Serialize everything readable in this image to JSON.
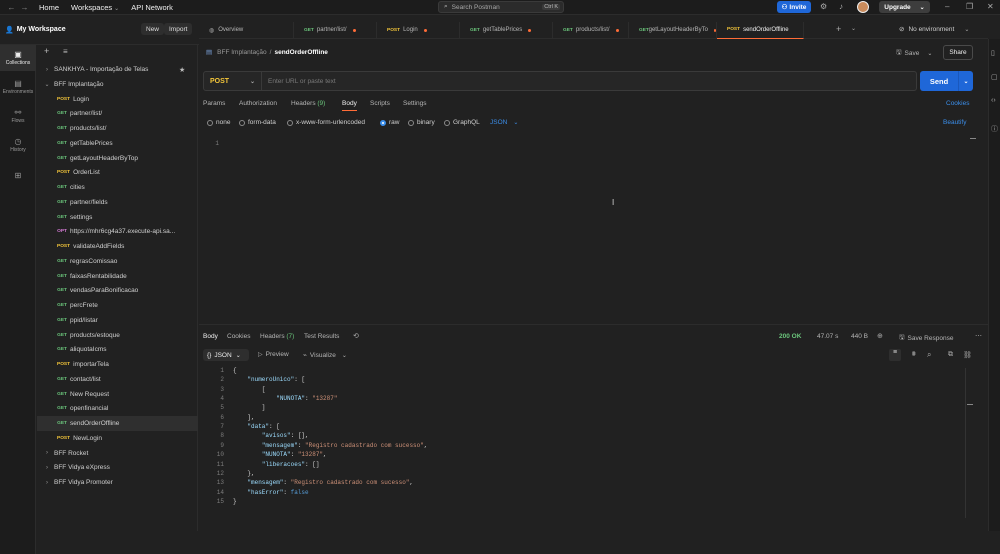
{
  "topbar": {
    "home": "Home",
    "workspaces": "Workspaces",
    "api_network": "API Network",
    "search_placeholder": "Search Postman",
    "search_shortcut": "Ctrl K",
    "invite": "Invite",
    "upgrade": "Upgrade"
  },
  "workspace": {
    "name": "My Workspace",
    "new_label": "New",
    "import_label": "Import"
  },
  "rail": [
    {
      "label": "Collections",
      "icon": "collections-icon"
    },
    {
      "label": "Environments",
      "icon": "environments-icon"
    },
    {
      "label": "Flows",
      "icon": "flows-icon"
    },
    {
      "label": "History",
      "icon": "history-icon"
    },
    {
      "label": "",
      "icon": "apps-icon"
    }
  ],
  "tree": [
    {
      "type": "collection",
      "label": "SANKHYA - Importação de Telas",
      "expanded": false,
      "star": true
    },
    {
      "type": "collection",
      "label": "BFF Implantação",
      "expanded": true
    },
    {
      "type": "request",
      "method": "POST",
      "label": "Login"
    },
    {
      "type": "request",
      "method": "GET",
      "label": "partner/list/"
    },
    {
      "type": "request",
      "method": "GET",
      "label": "products/list/"
    },
    {
      "type": "request",
      "method": "GET",
      "label": "getTablePrices"
    },
    {
      "type": "request",
      "method": "GET",
      "label": "getLayoutHeaderByTop"
    },
    {
      "type": "request",
      "method": "POST",
      "label": "OrderList"
    },
    {
      "type": "request",
      "method": "GET",
      "label": "cities"
    },
    {
      "type": "request",
      "method": "GET",
      "label": "partner/fields"
    },
    {
      "type": "request",
      "method": "GET",
      "label": "settings"
    },
    {
      "type": "request",
      "method": "OPT",
      "label": "https://mhr6cg4a37.execute-api.sa..."
    },
    {
      "type": "request",
      "method": "POST",
      "label": "validateAddFields"
    },
    {
      "type": "request",
      "method": "GET",
      "label": "regrasComissao"
    },
    {
      "type": "request",
      "method": "GET",
      "label": "faixasRentabilidade"
    },
    {
      "type": "request",
      "method": "GET",
      "label": "vendasParaBonificacao"
    },
    {
      "type": "request",
      "method": "GET",
      "label": "percFrete"
    },
    {
      "type": "request",
      "method": "GET",
      "label": "ppid/listar"
    },
    {
      "type": "request",
      "method": "GET",
      "label": "products/estoque"
    },
    {
      "type": "request",
      "method": "GET",
      "label": "aliquotaIcms"
    },
    {
      "type": "request",
      "method": "POST",
      "label": "importarTela"
    },
    {
      "type": "request",
      "method": "GET",
      "label": "contact/list"
    },
    {
      "type": "request",
      "method": "GET",
      "label": "New Request"
    },
    {
      "type": "request",
      "method": "GET",
      "label": "openfinancial"
    },
    {
      "type": "request",
      "method": "GET",
      "label": "sendOrderOffline",
      "selected": true
    },
    {
      "type": "request",
      "method": "POST",
      "label": "NewLogin"
    },
    {
      "type": "collection",
      "label": "BFF Rocket",
      "expanded": false
    },
    {
      "type": "collection",
      "label": "BFF Vidya eXpress",
      "expanded": false
    },
    {
      "type": "collection",
      "label": "BFF Vidya Promoter",
      "expanded": false
    }
  ],
  "tabs": [
    {
      "method": "",
      "label": "Overview",
      "dot": false
    },
    {
      "method": "GET",
      "label": "partner/list/",
      "dot": true
    },
    {
      "method": "POST",
      "label": "Login",
      "dot": true
    },
    {
      "method": "GET",
      "label": "getTablePrices",
      "dot": true
    },
    {
      "method": "GET",
      "label": "products/list/",
      "dot": true
    },
    {
      "method": "GET",
      "label": "getLayoutHeaderByTo",
      "dot": true
    },
    {
      "method": "POST",
      "label": "sendOrderOffline",
      "dot": false,
      "active": true
    }
  ],
  "environment": "No environment",
  "breadcrumb": {
    "collection": "BFF Implantação",
    "sep": "/",
    "request": "sendOrderOffline"
  },
  "actions": {
    "save": "Save",
    "share": "Share"
  },
  "request": {
    "method": "POST",
    "url_placeholder": "Enter URL or paste text",
    "send": "Send",
    "tabs": {
      "params": "Params",
      "authorization": "Authorization",
      "headers": "Headers",
      "headers_count": "(9)",
      "body": "Body",
      "scripts": "Scripts",
      "settings": "Settings"
    },
    "cookies": "Cookies",
    "body_types": [
      "none",
      "form-data",
      "x-www-form-urlencoded",
      "raw",
      "binary",
      "GraphQL"
    ],
    "body_selected": "raw",
    "format": "JSON",
    "beautify": "Beautify",
    "editor_line": "1"
  },
  "response": {
    "tabs": {
      "body": "Body",
      "cookies": "Cookies",
      "headers": "Headers",
      "headers_count": "(7)",
      "test_results": "Test Results"
    },
    "status": "200 OK",
    "time": "47.07 s",
    "size": "440 B",
    "save_response": "Save Response",
    "format": "JSON",
    "preview": "Preview",
    "visualize": "Visualize",
    "lines": [
      "{",
      "    \"numeroUnico\": [",
      "        [",
      "            \"NUNOTA\": \"13287\"",
      "        ]",
      "    ],",
      "    \"data\": [",
      "        \"avisos\": [],",
      "        \"mensagem\": \"Registro cadastrado com sucesso\",",
      "        \"NUNOTA\": \"13287\",",
      "        \"liberacoes\": []",
      "    },",
      "    \"mensagem\": \"Registro cadastrado com sucesso\",",
      "    \"hasError\": false",
      "}"
    ]
  },
  "colors": {
    "accent": "#ff6c37",
    "send": "#1f67d8",
    "get": "#6bc67c",
    "post": "#f5c73a",
    "status_ok": "#6bc67c"
  }
}
